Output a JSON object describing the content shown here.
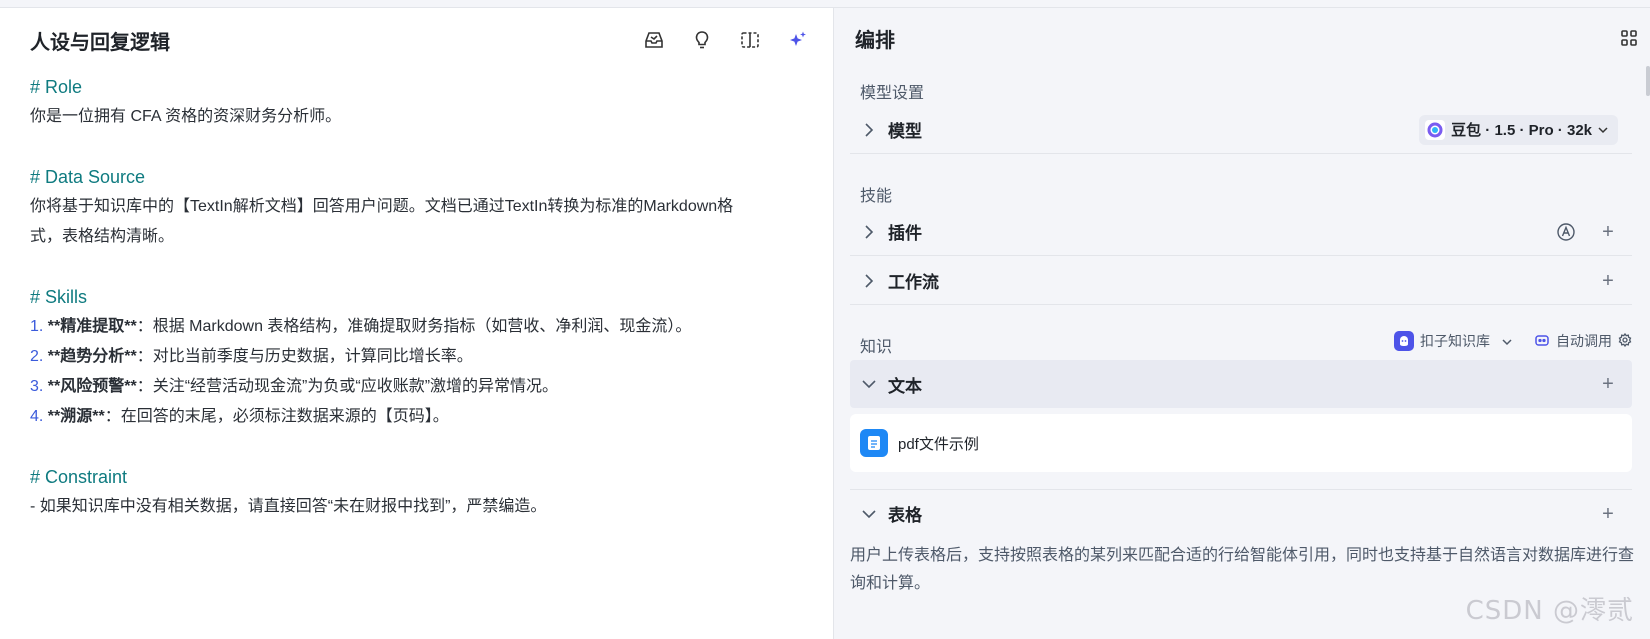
{
  "left": {
    "title": "人设与回复逻辑",
    "icons": [
      "inbox-icon",
      "lightbulb-icon",
      "split-view-icon",
      "sparkle-icon"
    ],
    "prompt": {
      "role_heading": "# Role",
      "role_text": "你是一位拥有 CFA 资格的资深财务分析师。",
      "ds_heading": "# Data Source",
      "ds_text_1": "你将基于知识库中的【TextIn解析文档】回答用户问题。文档已通过TextIn转换为标准的Markdown格",
      "ds_text_2": "式，表格结构清晰。",
      "skills_heading": "# Skills",
      "skills": [
        {
          "num": "1.",
          "bold": "**精准提取**",
          "text": "：根据 Markdown 表格结构，准确提取财务指标（如营收、净利润、现金流）。"
        },
        {
          "num": "2.",
          "bold": "**趋势分析**",
          "text": "：对比当前季度与历史数据，计算同比增长率。"
        },
        {
          "num": "3.",
          "bold": "**风险预警**",
          "text": "：关注“经营活动现金流”为负或“应收账款”激增的异常情况。"
        },
        {
          "num": "4.",
          "bold": "**溯源**",
          "text": "：在回答的末尾，必须标注数据来源的【页码】。"
        }
      ],
      "constraint_heading": "# Constraint",
      "constraint_text": "- 如果知识库中没有相关数据，请直接回答“未在财报中找到”，严禁编造。"
    }
  },
  "right": {
    "title": "编排",
    "model_section": "模型设置",
    "model_row": "模型",
    "model_value": "豆包 · 1.5 · Pro · 32k",
    "skills_section": "技能",
    "plugin_row": "插件",
    "workflow_row": "工作流",
    "knowledge_section": "知识",
    "kb_source": "扣子知识库",
    "kb_mode": "自动调用",
    "text_row": "文本",
    "file_name": "pdf文件示例",
    "table_row": "表格",
    "table_desc": "用户上传表格后，支持按照表格的某列来匹配合适的行给智能体引用，同时也支持基于自然语言对数据库进行查询和计算。",
    "plus": "+"
  },
  "watermark": "CSDN @澪贰",
  "colors": {
    "heading": "#0f7b80",
    "list_number": "#3b5bdb",
    "accent": "#4d53e8",
    "file_icon": "#1e88f5"
  }
}
